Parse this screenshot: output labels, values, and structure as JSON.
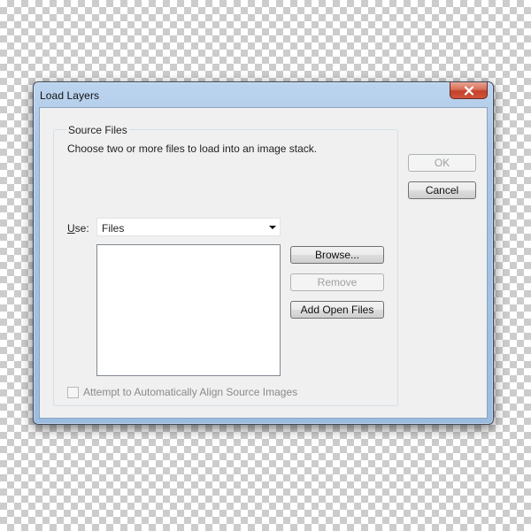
{
  "window": {
    "title": "Load Layers"
  },
  "group": {
    "legend": "Source Files",
    "description": "Choose two or more files to load into an image stack."
  },
  "use": {
    "label_mnemonic": "U",
    "label_rest": "se:",
    "selected": "Files"
  },
  "buttons": {
    "browse": "Browse...",
    "remove": "Remove",
    "add_open_files": "Add Open Files",
    "ok": "OK",
    "cancel": "Cancel"
  },
  "align_checkbox": {
    "label": "Attempt to Automatically Align Source Images",
    "checked": false,
    "enabled": false
  },
  "file_list": [],
  "icons": {
    "close": "close-icon",
    "dropdown": "chevron-down-icon"
  },
  "colors": {
    "close_button": "#c4402a",
    "window_frame": "#a9c5e6",
    "dialog_bg": "#f0f0f0"
  }
}
